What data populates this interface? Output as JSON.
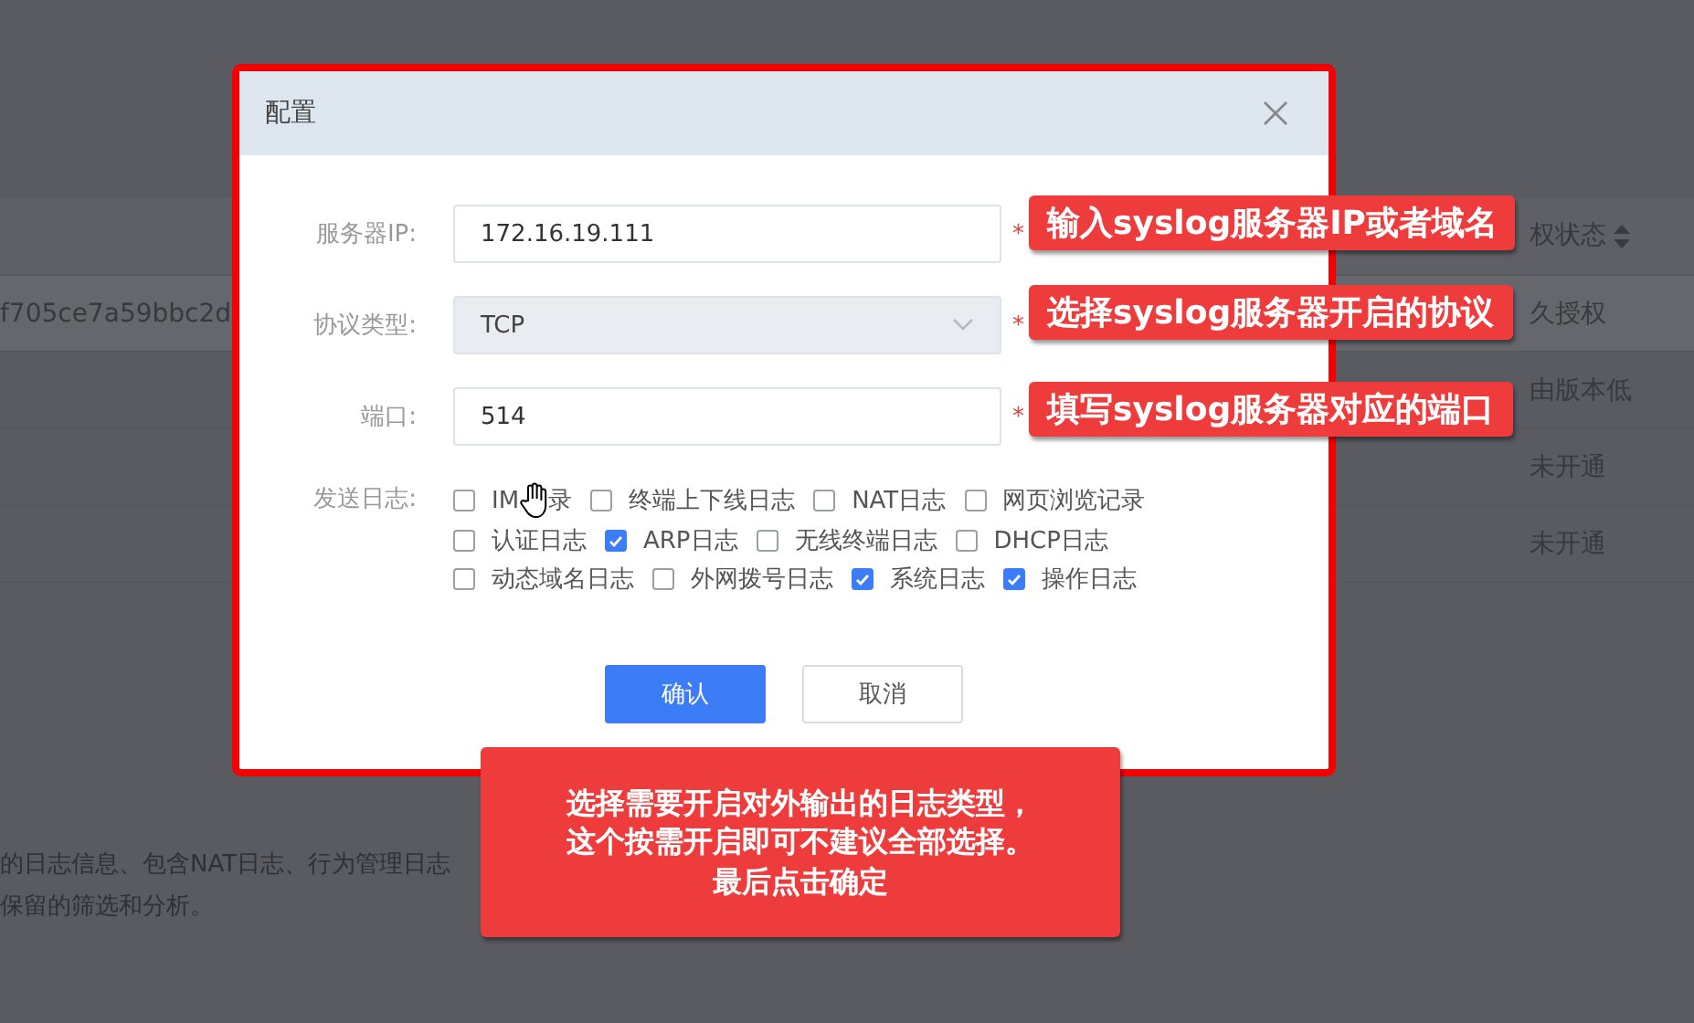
{
  "background": {
    "table": {
      "column_3_header": "权状态",
      "row_1_id": "f705ce7a59bbc2d",
      "column_3": [
        "久授权",
        "由版本低",
        "未开通",
        "未开通"
      ]
    },
    "description": [
      "的日志信息、包含NAT日志、行为管理日志",
      "保留的筛选和分析。"
    ]
  },
  "dialog": {
    "title": "配置",
    "fields": [
      {
        "kind": "input",
        "label": "服务器IP:",
        "value": "172.16.19.111",
        "disabled": false,
        "required_mark": "*"
      },
      {
        "kind": "select",
        "label": "协议类型:",
        "value": "TCP",
        "disabled": true,
        "required_mark": "*"
      },
      {
        "kind": "input",
        "label": "端口:",
        "value": "514",
        "disabled": false,
        "required_mark": "*"
      }
    ],
    "log_label": "发送日志:",
    "log_rows": [
      [
        {
          "label": "IM",
          "label_end": "录",
          "checked": false,
          "cursor": true
        },
        {
          "label": "终端上下线日志",
          "checked": false,
          "cursor": false
        },
        {
          "label": "NAT日志",
          "checked": false,
          "cursor": false
        },
        {
          "label": "网页浏览记录",
          "checked": false,
          "cursor": false
        }
      ],
      [
        {
          "label": "认证日志",
          "checked": false,
          "cursor": false
        },
        {
          "label": "ARP日志",
          "checked": true,
          "cursor": false
        },
        {
          "label": "无线终端日志",
          "checked": false,
          "cursor": false
        },
        {
          "label": "DHCP日志",
          "checked": false,
          "cursor": false
        }
      ],
      [
        {
          "label": "动态域名日志",
          "checked": false,
          "cursor": false
        },
        {
          "label": "外网拨号日志",
          "checked": false,
          "cursor": false
        },
        {
          "label": "系统日志",
          "checked": true,
          "cursor": false
        },
        {
          "label": "操作日志",
          "checked": true,
          "cursor": false
        }
      ]
    ],
    "buttons": [
      {
        "label": "确认",
        "kind": "primary"
      },
      {
        "label": "取消",
        "kind": "default"
      }
    ]
  },
  "callouts": [
    {
      "lines": [
        "输入syslog服务器IP或者域名"
      ]
    },
    {
      "lines": [
        "选择syslog服务器开启的协议"
      ]
    },
    {
      "lines": [
        "填写syslog服务器对应的端口"
      ]
    },
    {
      "lines": [
        "选择需要开启对外输出的日志类型，",
        "这个按需开启即可不建议全部选择。",
        "最后点击确定"
      ]
    }
  ]
}
